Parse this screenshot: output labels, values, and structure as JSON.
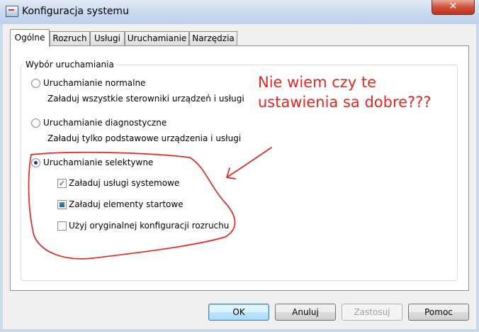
{
  "window": {
    "title": "Konfiguracja systemu",
    "close_symbol": "✕"
  },
  "tabs": [
    {
      "label": "Ogólne"
    },
    {
      "label": "Rozruch"
    },
    {
      "label": "Usługi"
    },
    {
      "label": "Uruchamianie"
    },
    {
      "label": "Narzędzia"
    }
  ],
  "startup_selection": {
    "legend": "Wybór uruchamiania",
    "normal": {
      "label": "Uruchamianie normalne",
      "description": "Załaduj wszystkie sterowniki urządzeń i usługi",
      "selected": false
    },
    "diagnostic": {
      "label": "Uruchamianie diagnostyczne",
      "description": "Załaduj tylko podstawowe urządzenia i usługi",
      "selected": false
    },
    "selective": {
      "label": "Uruchamianie selektywne",
      "selected": true
    },
    "options": [
      {
        "label": "Załaduj usługi systemowe",
        "state": "checked",
        "mark": "✓"
      },
      {
        "label": "Załaduj elementy startowe",
        "state": "indeterminate"
      },
      {
        "label": "Użyj oryginalnej konfiguracji rozruchu",
        "state": "unchecked"
      }
    ]
  },
  "annotation": {
    "text": "Nie wiem czy te\nustawienia sa dobre???",
    "color": "#e8251f"
  },
  "buttons": {
    "ok": "OK",
    "cancel": "Anuluj",
    "apply": "Zastosuj",
    "help": "Pomoc"
  },
  "colors": {
    "title_bar": "#c7d8ee",
    "close_button": "#c0331c",
    "default_button_border": "#3c7fb1"
  }
}
